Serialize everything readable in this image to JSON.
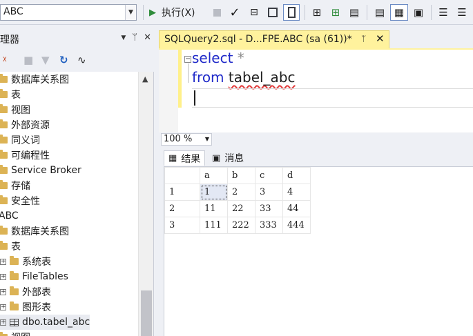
{
  "toolbar": {
    "database_value": "ABC",
    "execute_label": "执行(X)"
  },
  "explorer": {
    "title": "理器",
    "pin_glyph": "ᛘ",
    "close_glyph": "✕",
    "tree": [
      {
        "label": "数据库关系图",
        "kind": "folder"
      },
      {
        "label": "表",
        "kind": "folder"
      },
      {
        "label": "视图",
        "kind": "folder"
      },
      {
        "label": "外部资源",
        "kind": "folder"
      },
      {
        "label": "同义词",
        "kind": "folder"
      },
      {
        "label": "可编程性",
        "kind": "folder"
      },
      {
        "label": "Service Broker",
        "kind": "folder"
      },
      {
        "label": "存储",
        "kind": "folder"
      },
      {
        "label": "安全性",
        "kind": "folder"
      },
      {
        "label": "ABC",
        "kind": "db"
      },
      {
        "label": "数据库关系图",
        "kind": "folder"
      },
      {
        "label": "表",
        "kind": "folder"
      },
      {
        "label": "系统表",
        "kind": "child-folder"
      },
      {
        "label": "FileTables",
        "kind": "child-folder"
      },
      {
        "label": "外部表",
        "kind": "child-folder"
      },
      {
        "label": "图形表",
        "kind": "child-folder"
      },
      {
        "label": "dbo.tabel_abc",
        "kind": "table"
      },
      {
        "label": "视图",
        "kind": "folder"
      }
    ]
  },
  "editor": {
    "tab_title": "SQLQuery2.sql - D...FPE.ABC (sa (61))*",
    "line1_kw": "select",
    "line1_rest": " *",
    "line2_kw": "from",
    "line2_ident": "tabel_abc",
    "zoom": "100 %"
  },
  "results": {
    "tab_results": "结果",
    "tab_messages": "消息",
    "columns": [
      "a",
      "b",
      "c",
      "d"
    ],
    "rows": [
      {
        "num": "1",
        "cells": [
          "1",
          "2",
          "3",
          "4"
        ]
      },
      {
        "num": "2",
        "cells": [
          "11",
          "22",
          "33",
          "44"
        ]
      },
      {
        "num": "3",
        "cells": [
          "111",
          "222",
          "333",
          "444"
        ]
      }
    ]
  },
  "colors": {
    "keyword": "#1f29c9",
    "tab_active": "#fff29d",
    "execute_icon": "#2e8b3a"
  }
}
